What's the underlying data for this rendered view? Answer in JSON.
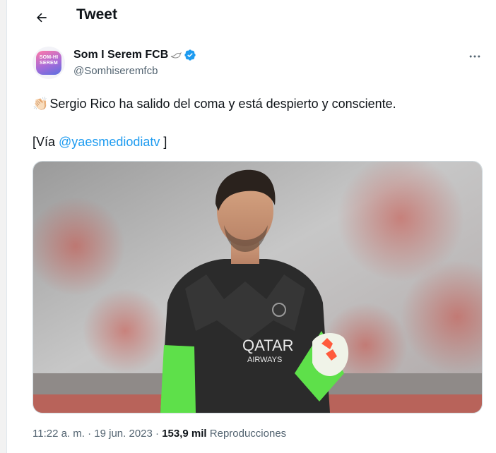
{
  "header": {
    "title": "Tweet",
    "back_icon": "arrow-left-icon"
  },
  "tweet": {
    "author": {
      "display_name": "Som I Serem FCB",
      "handle": "@Somhiseremfcb",
      "avatar_text_line1": "SOM-HI",
      "avatar_text_line2": "SEREM",
      "badge": "verified-badge-icon",
      "badge_color": "#1d9bf0",
      "accent_emoji": "bird-icon"
    },
    "more_icon": "more-dots-icon",
    "text_emoji": "👏🏻",
    "text": "Sergio Rico ha salido del coma y está despierto y consciente.",
    "via_prefix": "[Vía ",
    "via_mention": "@yaesmediodiatv",
    "via_suffix": " ]",
    "media": {
      "shirt_sponsor_line1": "QATAR",
      "shirt_sponsor_line2": "AIRWAYS",
      "colors": {
        "kit": "#2b2b2b",
        "sleeves": "#5ee04a",
        "crowd": "#b8473f"
      }
    },
    "meta": {
      "time": "11:22 a. m.",
      "separator": "·",
      "date": "19 jun. 2023",
      "views_count": "153,9 mil",
      "views_label": "Reproducciones"
    }
  }
}
